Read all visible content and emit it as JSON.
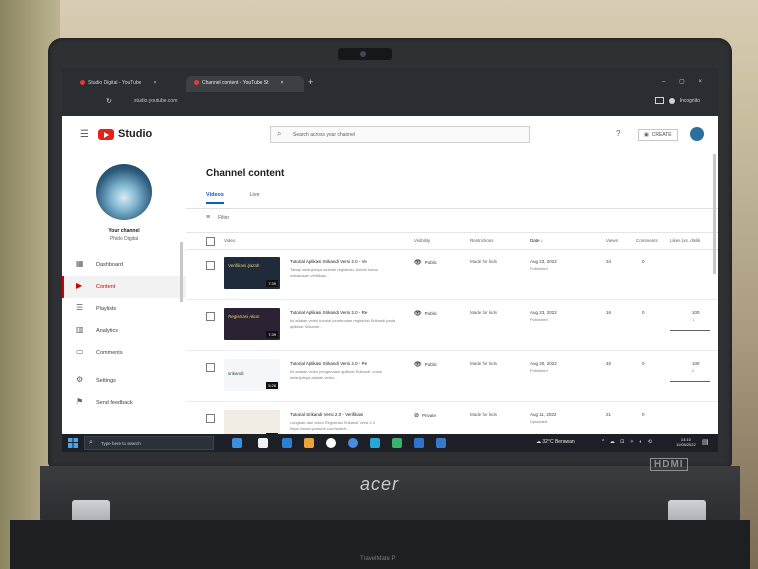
{
  "browser": {
    "tabs": [
      {
        "label": "Studio Digital - YouTube",
        "active": false
      },
      {
        "label": "Channel content - YouTube St",
        "active": true
      }
    ],
    "url": "studio.youtube.com",
    "profile_label": "Incognito",
    "new_tab": "+",
    "close": "×",
    "window_controls": "–  ▢  ×",
    "reload_icon": "↻"
  },
  "studio": {
    "brand": "Studio",
    "search_placeholder": "Search across your channel",
    "create_label": "CREATE",
    "help_icon": "?",
    "hamburger_icon": "☰"
  },
  "sidebar": {
    "your_channel": "Your channel",
    "channel_name": "Phido Digital",
    "items": [
      {
        "label": "Dashboard",
        "icon": "▦",
        "active": false
      },
      {
        "label": "Content",
        "icon": "▶",
        "active": true
      },
      {
        "label": "Playlists",
        "icon": "☰",
        "active": false
      },
      {
        "label": "Analytics",
        "icon": "▥",
        "active": false
      },
      {
        "label": "Comments",
        "icon": "▭",
        "active": false
      },
      {
        "label": "Settings",
        "icon": "⚙",
        "active": false
      },
      {
        "label": "Send feedback",
        "icon": "⚑",
        "active": false
      }
    ]
  },
  "content": {
    "title": "Channel content",
    "tabs": [
      {
        "label": "Videos",
        "active": true
      },
      {
        "label": "Live",
        "active": false
      }
    ],
    "filter_label": "Filter",
    "filter_icon": "≡",
    "columns": {
      "video": "Video",
      "visibility": "Visibility",
      "restrictions": "Restrictions",
      "date": "Date ↓",
      "views": "Views",
      "comments": "Comments",
      "likes": "Likes (vs. dislik"
    },
    "rows": [
      {
        "thumb_text": "Verifikasi Ijazah",
        "thumb_bg": "#1f2a3a",
        "duration": "7:39",
        "title": "Tutorial Aplikasi Srikandi Versi 2.0 - Ve",
        "desc": "Tahap selanjutnya setelah registrasi, Admin harus melakukan verifikasi...",
        "visibility": "Public",
        "vis_icon": "👁",
        "restrictions": "Made for kids",
        "date": "Aug 23, 2022",
        "date_sub": "Published",
        "views": "34",
        "comments": "0",
        "likes": "",
        "likes_sub": ""
      },
      {
        "thumb_text": "Registrasi Akun",
        "thumb_bg": "#2b2233",
        "duration": "7:39",
        "title": "Tutorial Aplikasi Srikandi Versi 2.0 - Re",
        "desc": "Ini adalah video tutorial pembuatan registrasi Srikandi pada aplikasi Srikandi...",
        "visibility": "Public",
        "vis_icon": "👁",
        "restrictions": "Made for kids",
        "date": "Aug 23, 2022",
        "date_sub": "Published",
        "views": "16",
        "comments": "0",
        "likes": "100",
        "likes_sub": "1"
      },
      {
        "thumb_text": "srikandi",
        "thumb_bg": "#f4f6f8",
        "duration": "5:28",
        "title": "Tutorial Aplikasi Srikandi Versi 2.0 - Pe",
        "desc": "Ini adalah video pengenalan aplikasi Srikandi, untuk selanjutnya adalah video...",
        "visibility": "Public",
        "vis_icon": "👁",
        "restrictions": "Made for kids",
        "date": "Aug 20, 2022",
        "date_sub": "Published",
        "views": "40",
        "comments": "0",
        "likes": "100",
        "likes_sub": "2"
      },
      {
        "thumb_text": "",
        "thumb_bg": "#f2ede4",
        "duration": "4:08",
        "title": "Tutorial Srikandi Versi 2.0 - Verifikasi",
        "desc": "Langkah dari video Registrasi Srikandi Versi 2.0 https://www.youtube.com/watch...",
        "visibility": "Private",
        "vis_icon": "⊘",
        "restrictions": "Made for kids",
        "date": "Aug 11, 2022",
        "date_sub": "Uploaded",
        "views": "21",
        "comments": "0",
        "likes": "",
        "likes_sub": ""
      }
    ]
  },
  "taskbar": {
    "search_placeholder": "Type here to search",
    "weather": "32°C Berawan",
    "tray": "^ ☁ ⊡ ✧ ◐ ⟲",
    "time": "13:10",
    "date": "11/08/2022",
    "apps": [
      "#3c8fdc",
      "#f0f0f0",
      "#2f7fd1",
      "#e8a33a",
      "#ffffff",
      "#4a8bdb",
      "#2aa7d8",
      "#3bb26b",
      "#2e74c9",
      "#3a78cc"
    ]
  },
  "laptop": {
    "brand": "acer",
    "model": "TravelMate P",
    "port": "HDMI"
  }
}
